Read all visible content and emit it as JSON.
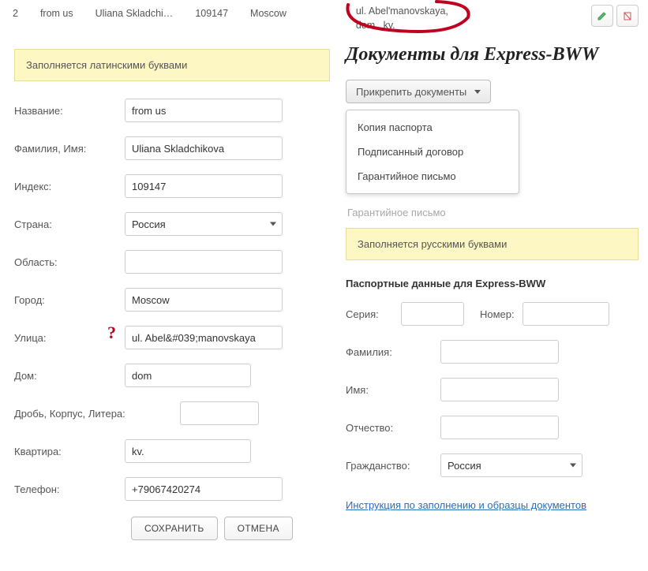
{
  "top": {
    "num": "2",
    "name": "from us",
    "fullname": "Uliana Skladchi…",
    "index": "109147",
    "city": "Moscow",
    "addr_line1": "ul. Abel'manovskaya,",
    "addr_line2": "dom     , kv."
  },
  "left": {
    "banner": "Заполняется латинскими буквами",
    "labels": {
      "name": "Название:",
      "fio": "Фамилия, Имя:",
      "index": "Индекс:",
      "country": "Страна:",
      "region": "Область:",
      "city": "Город:",
      "street": "Улица:",
      "house": "Дом:",
      "drob": "Дробь, Корпус, Литера:",
      "flat": "Квартира:",
      "phone": "Телефон:"
    },
    "values": {
      "name": "from us",
      "fio": "Uliana Skladchikova",
      "index": "109147",
      "country": "Россия",
      "region": "",
      "city": "Moscow",
      "street": "ul. Abel&#039;manovskaya",
      "house": "dom",
      "drob": "",
      "flat": "kv.",
      "phone": "+79067420274"
    },
    "buttons": {
      "save": "СОХРАНИТЬ",
      "cancel": "ОТМЕНА"
    }
  },
  "right": {
    "title": "Документы для Express-BWW",
    "attach": "Прикрепить документы",
    "dropdown": [
      "Копия паспорта",
      "Подписанный договор",
      "Гарантийное письмо"
    ],
    "muted": "Гарантийное письмо",
    "banner": "Заполняется русскими буквами",
    "passport_title": "Паспортные данные для Express-BWW",
    "labels": {
      "series": "Серия:",
      "number": "Номер:",
      "lastname": "Фамилия:",
      "firstname": "Имя:",
      "patronym": "Отчество:",
      "citizen": "Гражданство:"
    },
    "citizen_value": "Россия",
    "link": "Инструкция по заполнению и образцы документов"
  }
}
